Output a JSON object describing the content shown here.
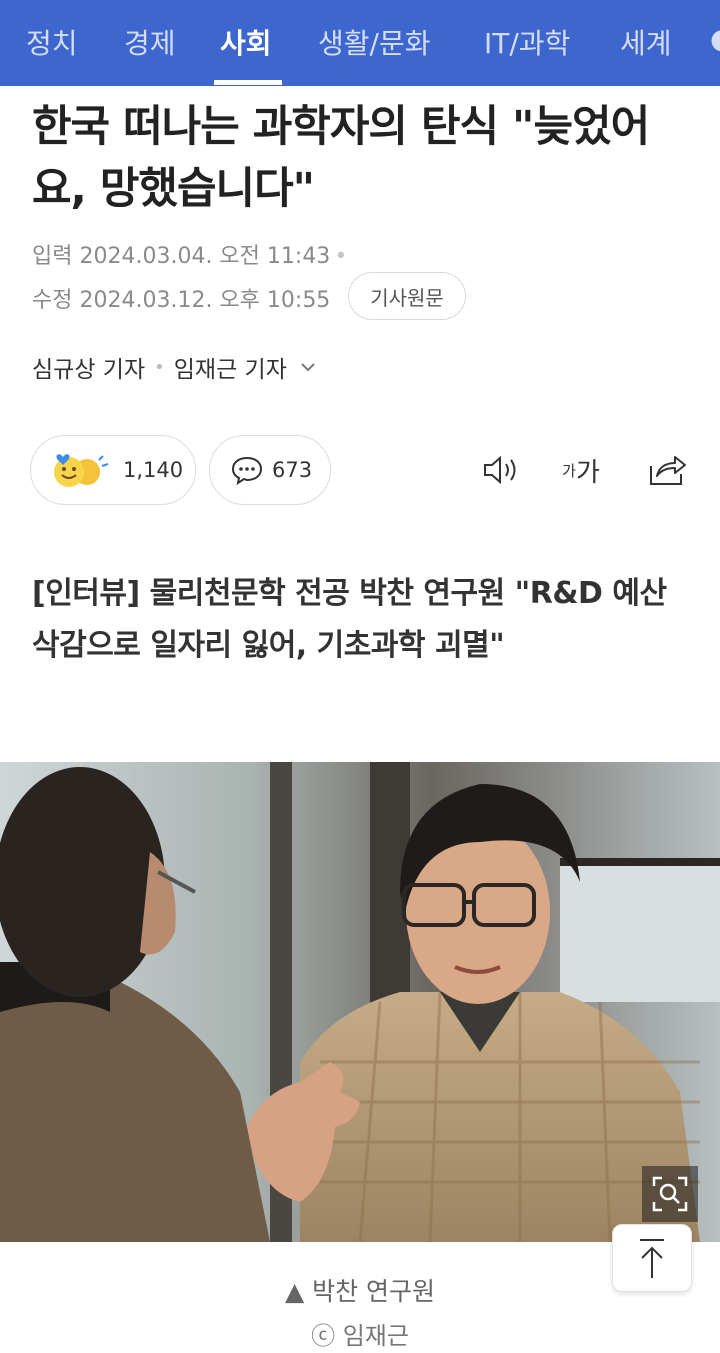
{
  "nav": {
    "tabs": [
      {
        "label": "정치"
      },
      {
        "label": "경제"
      },
      {
        "label": "사회"
      },
      {
        "label": "생활/문화"
      },
      {
        "label": "IT/과학"
      },
      {
        "label": "세계"
      }
    ],
    "active_tab": "사회",
    "active_color": "#ffffff",
    "bar_color": "#3d66cf"
  },
  "article": {
    "title": "한국 떠나는 과학자의 탄식 \"늦었어요, 망했습니다\"",
    "input_label": "입력",
    "input_time": "2024.03.04. 오전 11:43",
    "modified_label": "수정",
    "modified_time": "2024.03.12. 오후 10:55",
    "original_button": "기사원문",
    "reporters": [
      "심규상 기자",
      "임재근 기자"
    ],
    "reactions_count": "1,140",
    "comments_count": "673",
    "font_size_icon_label": "가가",
    "subtitle": "[인터뷰] 물리천문학 전공 박찬 연구원 \"R&D 예산 삭감으로 일자리 잃어, 기초과학 괴멸\"",
    "photo_caption": "▲ 박찬 연구원",
    "photo_credit": "ⓒ 임재근"
  },
  "icons": {
    "reactions": "emoji-reaction-icon",
    "comments": "speech-bubble-icon",
    "audio": "speaker-icon",
    "font_size": "font-size-icon",
    "share": "share-icon",
    "zoom": "zoom-magnifier-icon",
    "scroll_top": "arrow-up-icon",
    "reporter_expand": "chevron-down-icon"
  }
}
